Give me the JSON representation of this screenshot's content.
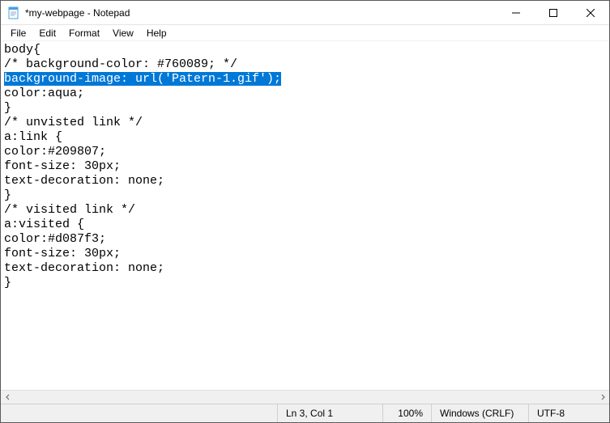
{
  "window": {
    "title": "*my-webpage - Notepad"
  },
  "menu": {
    "file": "File",
    "edit": "Edit",
    "format": "Format",
    "view": "View",
    "help": "Help"
  },
  "editor": {
    "lines": [
      "body{",
      "/* background-color: #760089; */"
    ],
    "selected_line": "background-image: url('Patern-1.gif');",
    "lines_after": [
      "color:aqua;",
      "}",
      "/* unvisted link */",
      "a:link {",
      "color:#209807;",
      "font-size: 30px;",
      "text-decoration: none;",
      "}",
      "/* visited link */",
      "a:visited {",
      "color:#d087f3;",
      "font-size: 30px;",
      "text-decoration: none;",
      "}"
    ]
  },
  "status": {
    "position": "Ln 3, Col 1",
    "zoom": "100%",
    "line_ending": "Windows (CRLF)",
    "encoding": "UTF-8"
  }
}
